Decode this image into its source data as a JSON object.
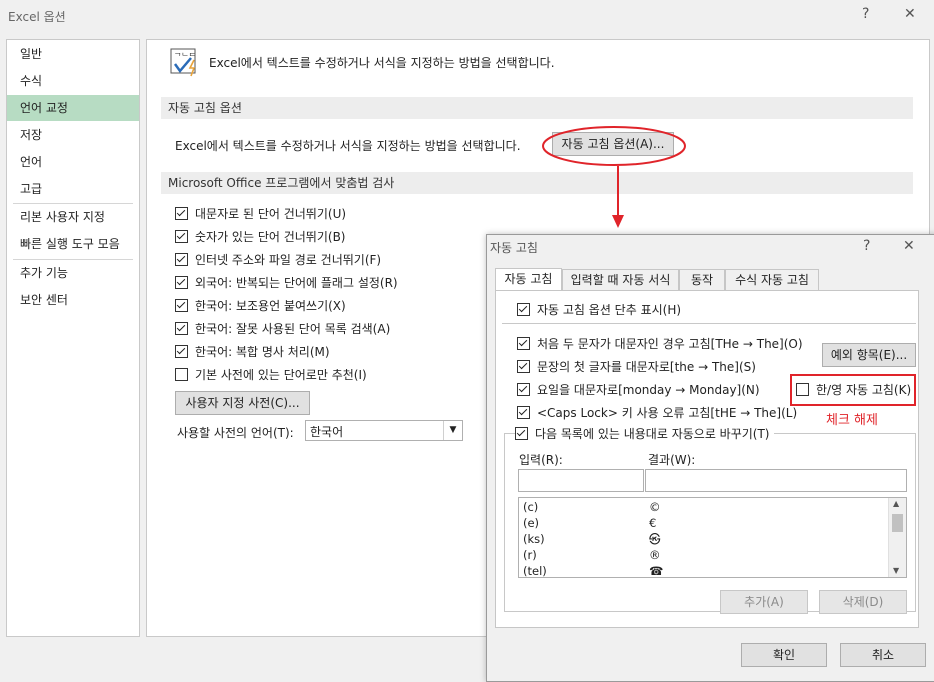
{
  "window": {
    "title": "Excel 옵션",
    "help_icon": "?",
    "close_icon": "✕"
  },
  "nav": {
    "items": [
      "일반",
      "수식",
      "언어 교정",
      "저장",
      "언어",
      "고급",
      "리본 사용자 지정",
      "빠른 실행 도구 모음",
      "추가 기능",
      "보안 센터"
    ],
    "selected": "언어 교정"
  },
  "main": {
    "header_text": "Excel에서 텍스트를 수정하거나 서식을 지정하는 방법을 선택합니다.",
    "section1_title": "자동 고침 옵션",
    "section1_text": "Excel에서 텍스트를 수정하거나 서식을 지정하는 방법을 선택합니다.",
    "autocorrect_button": "자동 고침 옵션(A)...",
    "section2_title": "Microsoft Office 프로그램에서 맞춤법 검사",
    "checkboxes": [
      {
        "label": "대문자로 된 단어 건너뛰기(U)",
        "checked": true
      },
      {
        "label": "숫자가 있는 단어 건너뛰기(B)",
        "checked": true
      },
      {
        "label": "인터넷 주소와 파일 경로 건너뛰기(F)",
        "checked": true
      },
      {
        "label": "외국어: 반복되는 단어에 플래그 설정(R)",
        "checked": true
      },
      {
        "label": "한국어: 보조용언 붙여쓰기(X)",
        "checked": true
      },
      {
        "label": "한국어: 잘못 사용된 단어 목록 검색(A)",
        "checked": true
      },
      {
        "label": "한국어: 복합 명사 처리(M)",
        "checked": true
      },
      {
        "label": "기본 사전에 있는 단어로만 추천(I)",
        "checked": false
      }
    ],
    "custom_dict_button": "사용자 지정 사전(C)...",
    "dict_lang_label": "사용할 사전의 언어(T):",
    "dict_lang_value": "한국어"
  },
  "dialog": {
    "title": "자동 고침",
    "help_icon": "?",
    "close_icon": "✕",
    "tabs": [
      "자동 고침",
      "입력할 때 자동 서식",
      "동작",
      "수식 자동 고침"
    ],
    "active_tab": "자동 고침",
    "show_buttons": {
      "label": "자동 고침 옵션 단추 표시(H)",
      "checked": true
    },
    "options": [
      {
        "label": "처음 두 문자가 대문자인 경우 고침[THe → The](O)",
        "checked": true
      },
      {
        "label": "문장의 첫 글자를 대문자로[the → The](S)",
        "checked": true
      },
      {
        "label": "요일을 대문자로[monday → Monday](N)",
        "checked": true
      },
      {
        "label": "<Caps Lock> 키 사용 오류 고침[tHE → The](L)",
        "checked": true
      }
    ],
    "exceptions_button": "예외 항목(E)...",
    "hanyoung": {
      "label": "한/영 자동 고침(K)",
      "checked": false
    },
    "annotation": "체크 해제",
    "replace_as_you_type": {
      "label": "다음 목록에 있는 내용대로 자동으로 바꾸기(T)",
      "checked": true
    },
    "input_label": "입력(R):",
    "result_label": "결과(W):",
    "list": [
      {
        "input": "(c)",
        "result": "©"
      },
      {
        "input": "(e)",
        "result": "€"
      },
      {
        "input": "(ks)",
        "result": "㉿"
      },
      {
        "input": "(r)",
        "result": "®"
      },
      {
        "input": "(tel)",
        "result": "☎"
      }
    ],
    "add_button": "추가(A)",
    "delete_button": "삭제(D)",
    "ok_button": "확인",
    "cancel_button": "취소"
  },
  "colors": {
    "accent_red": "#e0242a",
    "nav_selected": "#b7dcc3"
  }
}
